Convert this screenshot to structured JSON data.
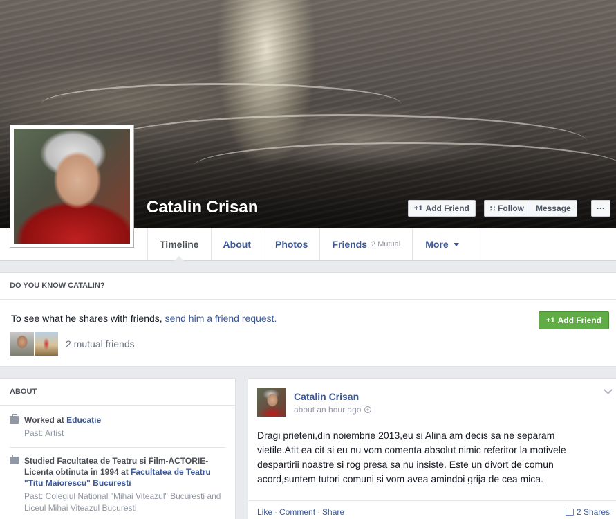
{
  "profile": {
    "name": "Catalin Crisan"
  },
  "cover_actions": {
    "add_friend": "Add Friend",
    "follow": "Follow",
    "message": "Message",
    "more": "···"
  },
  "tabs": [
    {
      "label": "Timeline",
      "sub": ""
    },
    {
      "label": "About",
      "sub": ""
    },
    {
      "label": "Photos",
      "sub": ""
    },
    {
      "label": "Friends",
      "sub": "2 Mutual"
    },
    {
      "label": "More",
      "sub": ""
    }
  ],
  "do_you_know": {
    "heading": "DO YOU KNOW CATALIN?",
    "text_before": "To see what he shares with friends, ",
    "link": "send him a friend request.",
    "add_friend": "Add Friend",
    "mutual": "2 mutual friends"
  },
  "about": {
    "heading": "ABOUT",
    "work": {
      "prefix": "Worked at ",
      "employer": "Educație",
      "past": "Past: Artist"
    },
    "education": {
      "prefix": "Studied Facultatea de Teatru si Film-ACTORIE-Licenta obtinuta in 1994 at ",
      "school": "Facultatea de Teatru \"Titu Maiorescu\" Bucuresti",
      "past": "Past: Colegiul National \"Mihai Viteazul\" Bucuresti and Liceul Mihai Viteazul Bucuresti"
    }
  },
  "post": {
    "author": "Catalin Crisan",
    "time": "about an hour ago",
    "body": "Dragi prieteni,din noiembrie 2013,eu si Alina am decis sa ne separam vietile.Atit ea cit si eu nu vom comenta absolut nimic referitor la motivele despartirii noastre si rog presa sa nu insiste. Este un divort de comun acord,suntem tutori comuni si vom avea amindoi grija de cea mica.",
    "actions": {
      "like": "Like",
      "comment": "Comment",
      "share": "Share",
      "sep": "·"
    },
    "shares": "2 Shares"
  }
}
